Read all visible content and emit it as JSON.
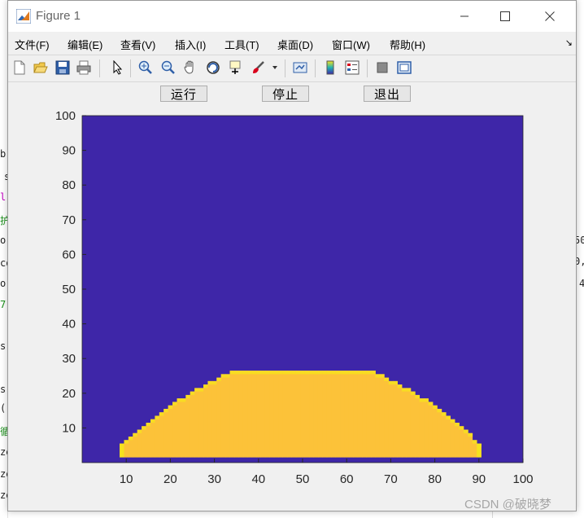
{
  "window": {
    "title": "Figure 1"
  },
  "menu": [
    "文件(F)",
    "编辑(E)",
    "查看(V)",
    "插入(I)",
    "工具(T)",
    "桌面(D)",
    "窗口(W)",
    "帮助(H)"
  ],
  "toolbar": {
    "icons": [
      "new-figure-icon",
      "open-file-icon",
      "save-icon",
      "print-icon",
      "pointer-icon",
      "zoom-in-icon",
      "zoom-out-icon",
      "pan-hand-icon",
      "rotate-3d-icon",
      "data-cursor-icon",
      "brush-icon",
      "brush-dropdown-icon",
      "link-plot-icon",
      "colorbar-icon",
      "legend-icon",
      "hide-plot-tools-icon",
      "show-plot-tools-icon"
    ]
  },
  "buttons": {
    "run": "运行",
    "stop": "停止",
    "exit": "退出"
  },
  "colors": {
    "background_cells": "#3e26a8",
    "filled_cells": "#fcc239",
    "edge_cells": "#f6e21e"
  },
  "chart_data": {
    "type": "heatmap",
    "title": "",
    "xlabel": "",
    "ylabel": "",
    "xlim": [
      0,
      100
    ],
    "ylim": [
      0,
      100
    ],
    "xticks": [
      10,
      20,
      30,
      40,
      50,
      60,
      70,
      80,
      90,
      100
    ],
    "yticks": [
      10,
      20,
      30,
      40,
      50,
      60,
      70,
      80,
      90,
      100
    ],
    "grid": false,
    "filled_region_profile": {
      "description_of_values": "top row of filled cells per column",
      "x": [
        9,
        10,
        11,
        12,
        13,
        14,
        15,
        16,
        17,
        18,
        19,
        20,
        21,
        22,
        23,
        24,
        25,
        26,
        27,
        28,
        29,
        30,
        31,
        32,
        33,
        34,
        66,
        67,
        68,
        69,
        70,
        71,
        72,
        73,
        74,
        75,
        76,
        77,
        78,
        79,
        80,
        81,
        82,
        83,
        84,
        85,
        86,
        87,
        88,
        89,
        90
      ],
      "top": [
        5,
        6,
        7,
        8,
        9,
        10,
        11,
        12,
        13,
        14,
        15,
        16,
        17,
        18,
        18,
        19,
        20,
        21,
        21,
        22,
        23,
        23,
        24,
        25,
        25,
        26,
        26,
        25,
        25,
        24,
        23,
        23,
        22,
        21,
        21,
        20,
        19,
        18,
        18,
        17,
        16,
        15,
        14,
        13,
        12,
        11,
        10,
        9,
        8,
        6,
        5
      ],
      "plateau": {
        "x_from": 34,
        "x_to": 65,
        "top": 26
      },
      "bottom": 2
    }
  },
  "background_fragments": [
    "b",
    "s",
    "l",
    "护",
    "or",
    "co",
    "or",
    "7",
    "s",
    "s",
    "(r",
    "循",
    "ze",
    "ze",
    "ze",
    "50",
    "0,",
    "4"
  ],
  "watermark": "CSDN @破晓梦"
}
